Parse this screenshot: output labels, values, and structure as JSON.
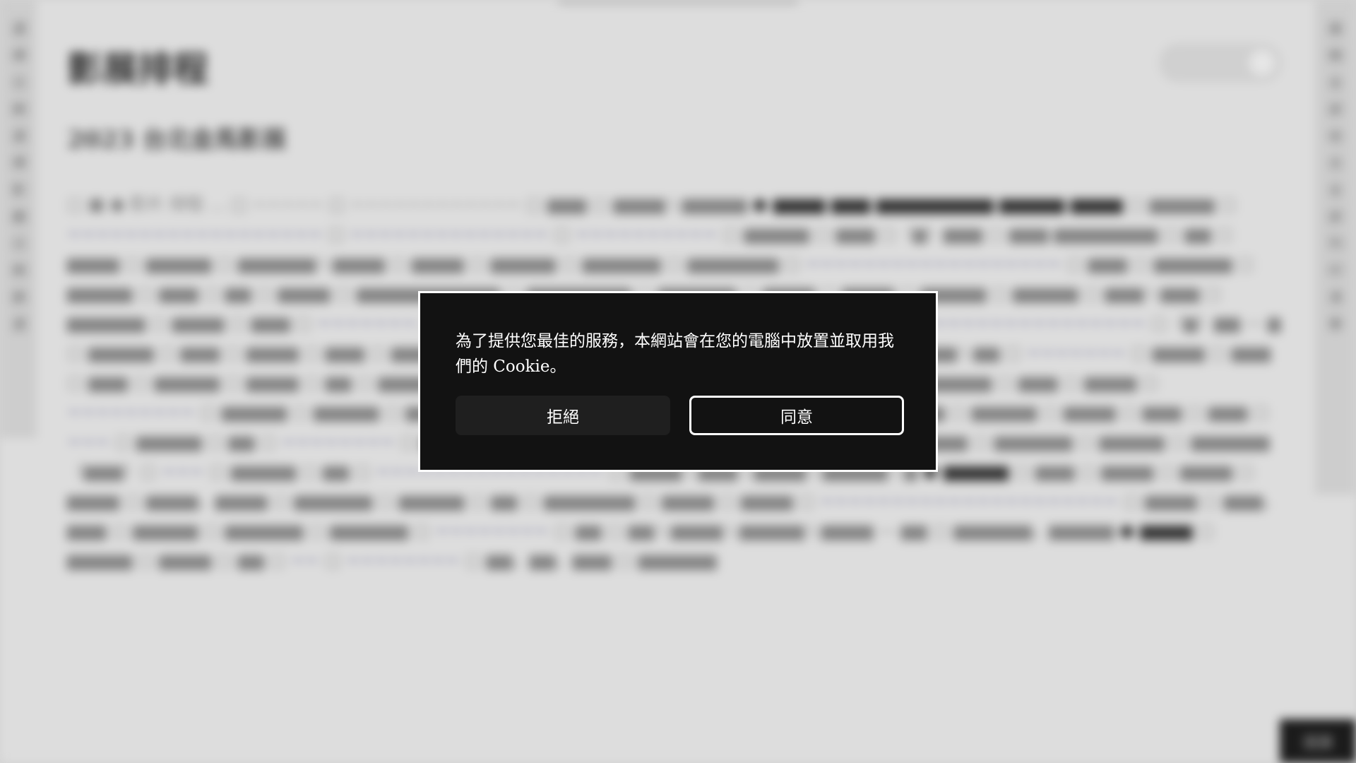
{
  "background": {
    "page_title": "影展排程",
    "page_subtitle": "2023 台北金馬影展",
    "left_rail_text": "選擇日期選擇影廳日期篩選",
    "right_rail_text": "展開全部收合全部列印清單",
    "corner_button_label": "回頂",
    "body_text": "□ ■ ● 影片 排程 …"
  },
  "cookie_banner": {
    "message": "為了提供您最佳的服務，本網站會在您的電腦中放置並取用我們的 Cookie。",
    "reject_label": "拒絕",
    "accept_label": "同意"
  },
  "colors": {
    "dialog_background": "#121212",
    "dialog_border": "#ffffff",
    "reject_button_background": "#1f1f1f"
  }
}
